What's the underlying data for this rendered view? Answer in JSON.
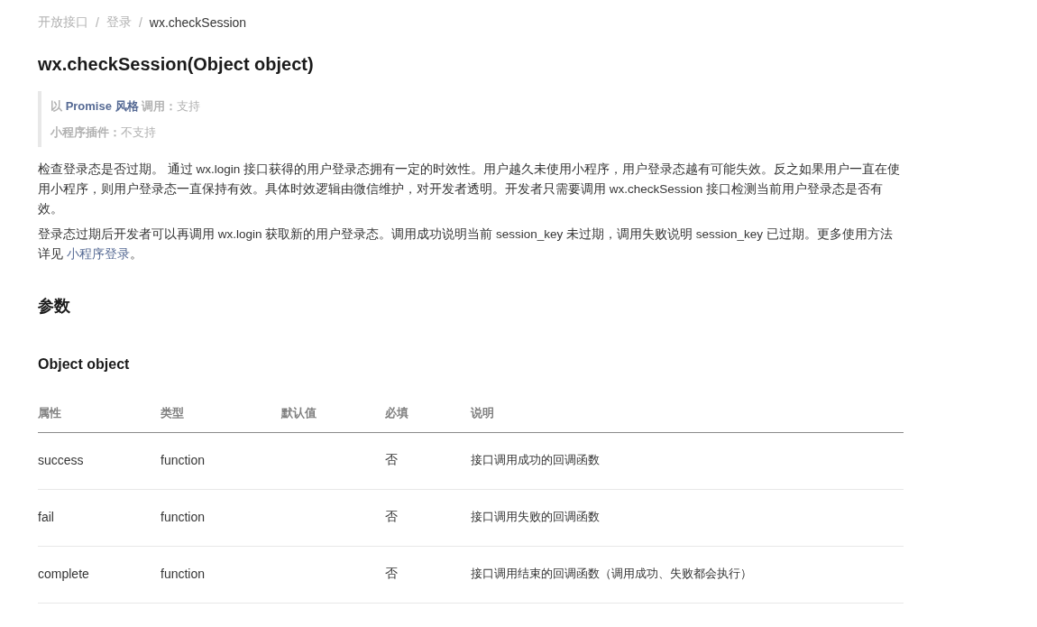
{
  "breadcrumb": [
    {
      "label": "开放接口",
      "current": false
    },
    {
      "label": "登录",
      "current": false
    },
    {
      "label": "wx.checkSession",
      "current": true
    }
  ],
  "breadcrumb_separator": "/",
  "title": "wx.checkSession(Object object)",
  "notes": [
    {
      "before": "以 ",
      "link": "Promise 风格",
      "after": " 调用：",
      "value": "支持"
    },
    {
      "before": "小程序插件：",
      "value": "不支持"
    }
  ],
  "paragraphs": [
    {
      "text": "检查登录态是否过期。 通过 wx.login 接口获得的用户登录态拥有一定的时效性。用户越久未使用小程序，用户登录态越有可能失效。反之如果用户一直在使用小程序，则用户登录态一直保持有效。具体时效逻辑由微信维护，对开发者透明。开发者只需要调用 wx.checkSession 接口检测当前用户登录态是否有效。"
    },
    {
      "text": "登录态过期后开发者可以再调用 wx.login 获取新的用户登录态。调用成功说明当前 session_key 未过期，调用失败说明 session_key 已过期。更多使用方法详见 ",
      "link": "小程序登录",
      "after": "。"
    }
  ],
  "section_heading": "参数",
  "subsection_heading": "Object object",
  "table": {
    "columns": [
      "属性",
      "类型",
      "默认值",
      "必填",
      "说明"
    ],
    "rows": [
      [
        "success",
        "function",
        "",
        "否",
        "接口调用成功的回调函数"
      ],
      [
        "fail",
        "function",
        "",
        "否",
        "接口调用失败的回调函数"
      ],
      [
        "complete",
        "function",
        "",
        "否",
        "接口调用结束的回调函数（调用成功、失败都会执行）"
      ]
    ]
  }
}
